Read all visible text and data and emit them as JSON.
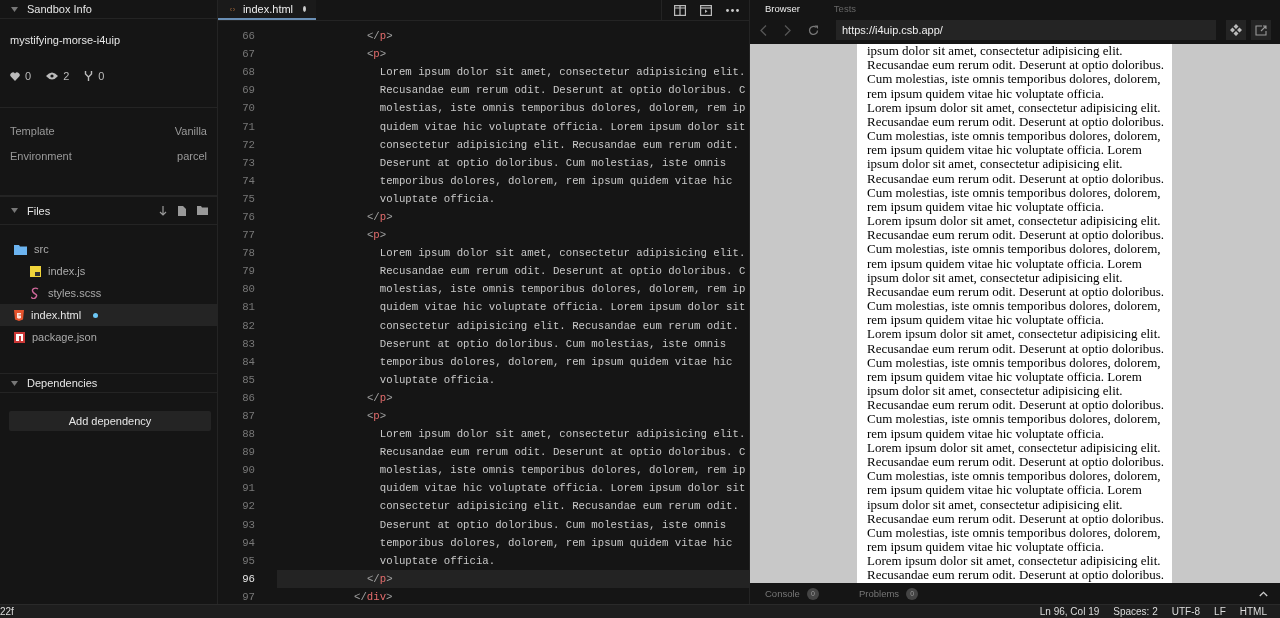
{
  "sidebar": {
    "info": {
      "title": "Sandbox Info",
      "name": "mystifying-morse-i4uip",
      "stats": [
        {
          "kind": "likes",
          "value": "0"
        },
        {
          "kind": "views",
          "value": "2"
        },
        {
          "kind": "forks",
          "value": "0"
        }
      ],
      "details": [
        {
          "label": "Template",
          "value": "Vanilla"
        },
        {
          "label": "Environment",
          "value": "parcel"
        }
      ]
    },
    "files": {
      "title": "Files",
      "items": [
        {
          "name": "src",
          "kind": "folder",
          "selected": false,
          "modified": false,
          "children": [
            {
              "name": "index.js",
              "kind": "js",
              "selected": false,
              "modified": false
            },
            {
              "name": "styles.scss",
              "kind": "scss",
              "selected": false,
              "modified": false
            }
          ]
        },
        {
          "name": "index.html",
          "kind": "html",
          "selected": true,
          "modified": true
        },
        {
          "name": "package.json",
          "kind": "json",
          "selected": false,
          "modified": false
        }
      ]
    },
    "dependencies": {
      "title": "Dependencies",
      "button": "Add dependency"
    }
  },
  "editor": {
    "tab": {
      "label": "index.html",
      "modified": true
    },
    "lines": [
      {
        "n": "66",
        "kind": "tag",
        "selected": false,
        "tokens": [
          {
            "t": "</",
            "kind": "punct"
          },
          {
            "t": "p",
            "kind": "tag"
          },
          {
            "t": ">",
            "kind": "punct"
          }
        ]
      },
      {
        "n": "67",
        "kind": "tag",
        "selected": false,
        "tokens": [
          {
            "t": "<",
            "kind": "punct"
          },
          {
            "t": "p",
            "kind": "tag"
          },
          {
            "t": ">",
            "kind": "punct"
          }
        ]
      },
      {
        "n": "68",
        "kind": "text",
        "selected": false,
        "tokens": [
          {
            "t": "Lorem ipsum dolor sit amet, consectetur adipisicing elit.",
            "kind": "text"
          }
        ]
      },
      {
        "n": "69",
        "kind": "text",
        "selected": false,
        "tokens": [
          {
            "t": "Recusandae eum rerum odit. Deserunt at optio doloribus. C",
            "kind": "text"
          }
        ]
      },
      {
        "n": "70",
        "kind": "text",
        "selected": false,
        "tokens": [
          {
            "t": "molestias, iste omnis temporibus dolores, dolorem, rem ip",
            "kind": "text"
          }
        ]
      },
      {
        "n": "71",
        "kind": "text",
        "selected": false,
        "tokens": [
          {
            "t": "quidem vitae hic voluptate officia. Lorem ipsum dolor sit",
            "kind": "text"
          }
        ]
      },
      {
        "n": "72",
        "kind": "text",
        "selected": false,
        "tokens": [
          {
            "t": "consectetur adipisicing elit. Recusandae eum rerum odit.",
            "kind": "text"
          }
        ]
      },
      {
        "n": "73",
        "kind": "text",
        "selected": false,
        "tokens": [
          {
            "t": "Deserunt at optio doloribus. Cum molestias, iste omnis",
            "kind": "text"
          }
        ]
      },
      {
        "n": "74",
        "kind": "text",
        "selected": false,
        "tokens": [
          {
            "t": "temporibus dolores, dolorem, rem ipsum quidem vitae hic",
            "kind": "text"
          }
        ]
      },
      {
        "n": "75",
        "kind": "text",
        "selected": false,
        "tokens": [
          {
            "t": "voluptate officia.",
            "kind": "text"
          }
        ]
      },
      {
        "n": "76",
        "kind": "tag",
        "selected": false,
        "tokens": [
          {
            "t": "</",
            "kind": "punct"
          },
          {
            "t": "p",
            "kind": "tag"
          },
          {
            "t": ">",
            "kind": "punct"
          }
        ]
      },
      {
        "n": "77",
        "kind": "tag",
        "selected": false,
        "tokens": [
          {
            "t": "<",
            "kind": "punct"
          },
          {
            "t": "p",
            "kind": "tag"
          },
          {
            "t": ">",
            "kind": "punct"
          }
        ]
      },
      {
        "n": "78",
        "kind": "text",
        "selected": false,
        "tokens": [
          {
            "t": "Lorem ipsum dolor sit amet, consectetur adipisicing elit.",
            "kind": "text"
          }
        ]
      },
      {
        "n": "79",
        "kind": "text",
        "selected": false,
        "tokens": [
          {
            "t": "Recusandae eum rerum odit. Deserunt at optio doloribus. C",
            "kind": "text"
          }
        ]
      },
      {
        "n": "80",
        "kind": "text",
        "selected": false,
        "tokens": [
          {
            "t": "molestias, iste omnis temporibus dolores, dolorem, rem ip",
            "kind": "text"
          }
        ]
      },
      {
        "n": "81",
        "kind": "text",
        "selected": false,
        "tokens": [
          {
            "t": "quidem vitae hic voluptate officia. Lorem ipsum dolor sit",
            "kind": "text"
          }
        ]
      },
      {
        "n": "82",
        "kind": "text",
        "selected": false,
        "tokens": [
          {
            "t": "consectetur adipisicing elit. Recusandae eum rerum odit.",
            "kind": "text"
          }
        ]
      },
      {
        "n": "83",
        "kind": "text",
        "selected": false,
        "tokens": [
          {
            "t": "Deserunt at optio doloribus. Cum molestias, iste omnis",
            "kind": "text"
          }
        ]
      },
      {
        "n": "84",
        "kind": "text",
        "selected": false,
        "tokens": [
          {
            "t": "temporibus dolores, dolorem, rem ipsum quidem vitae hic",
            "kind": "text"
          }
        ]
      },
      {
        "n": "85",
        "kind": "text",
        "selected": false,
        "tokens": [
          {
            "t": "voluptate officia.",
            "kind": "text"
          }
        ]
      },
      {
        "n": "86",
        "kind": "tag",
        "selected": false,
        "tokens": [
          {
            "t": "</",
            "kind": "punct"
          },
          {
            "t": "p",
            "kind": "tag"
          },
          {
            "t": ">",
            "kind": "punct"
          }
        ]
      },
      {
        "n": "87",
        "kind": "tag",
        "selected": false,
        "tokens": [
          {
            "t": "<",
            "kind": "punct"
          },
          {
            "t": "p",
            "kind": "tag"
          },
          {
            "t": ">",
            "kind": "punct"
          }
        ]
      },
      {
        "n": "88",
        "kind": "text",
        "selected": false,
        "tokens": [
          {
            "t": "Lorem ipsum dolor sit amet, consectetur adipisicing elit.",
            "kind": "text"
          }
        ]
      },
      {
        "n": "89",
        "kind": "text",
        "selected": false,
        "tokens": [
          {
            "t": "Recusandae eum rerum odit. Deserunt at optio doloribus. C",
            "kind": "text"
          }
        ]
      },
      {
        "n": "90",
        "kind": "text",
        "selected": false,
        "tokens": [
          {
            "t": "molestias, iste omnis temporibus dolores, dolorem, rem ip",
            "kind": "text"
          }
        ]
      },
      {
        "n": "91",
        "kind": "text",
        "selected": false,
        "tokens": [
          {
            "t": "quidem vitae hic voluptate officia. Lorem ipsum dolor sit",
            "kind": "text"
          }
        ]
      },
      {
        "n": "92",
        "kind": "text",
        "selected": false,
        "tokens": [
          {
            "t": "consectetur adipisicing elit. Recusandae eum rerum odit.",
            "kind": "text"
          }
        ]
      },
      {
        "n": "93",
        "kind": "text",
        "selected": false,
        "tokens": [
          {
            "t": "Deserunt at optio doloribus. Cum molestias, iste omnis",
            "kind": "text"
          }
        ]
      },
      {
        "n": "94",
        "kind": "text",
        "selected": false,
        "tokens": [
          {
            "t": "temporibus dolores, dolorem, rem ipsum quidem vitae hic",
            "kind": "text"
          }
        ]
      },
      {
        "n": "95",
        "kind": "text",
        "selected": false,
        "tokens": [
          {
            "t": "voluptate officia.",
            "kind": "text"
          }
        ]
      },
      {
        "n": "96",
        "kind": "tag",
        "selected": true,
        "tokens": [
          {
            "t": "</",
            "kind": "punct"
          },
          {
            "t": "p",
            "kind": "tag"
          },
          {
            "t": ">",
            "kind": "punct"
          }
        ]
      },
      {
        "n": "97",
        "kind": "outer",
        "selected": false,
        "tokens": [
          {
            "t": "</",
            "kind": "punct"
          },
          {
            "t": "div",
            "kind": "tag"
          },
          {
            "t": ">",
            "kind": "punct"
          }
        ]
      }
    ]
  },
  "preview": {
    "tabs": [
      {
        "label": "Browser",
        "selected": true
      },
      {
        "label": "Tests",
        "selected": false
      }
    ],
    "url": "https://i4uip.csb.app/",
    "lines": [
      "ipsum dolor sit amet, consectetur adipisicing elit.",
      "Recusandae eum rerum odit. Deserunt at optio doloribus.",
      "Cum molestias, iste omnis temporibus dolores, dolorem,",
      "rem ipsum quidem vitae hic voluptate officia.",
      "Lorem ipsum dolor sit amet, consectetur adipisicing elit.",
      "Recusandae eum rerum odit. Deserunt at optio doloribus.",
      "Cum molestias, iste omnis temporibus dolores, dolorem,",
      "rem ipsum quidem vitae hic voluptate officia. Lorem",
      "ipsum dolor sit amet, consectetur adipisicing elit.",
      "Recusandae eum rerum odit. Deserunt at optio doloribus.",
      "Cum molestias, iste omnis temporibus dolores, dolorem,",
      "rem ipsum quidem vitae hic voluptate officia.",
      "Lorem ipsum dolor sit amet, consectetur adipisicing elit.",
      "Recusandae eum rerum odit. Deserunt at optio doloribus.",
      "Cum molestias, iste omnis temporibus dolores, dolorem,",
      "rem ipsum quidem vitae hic voluptate officia. Lorem",
      "ipsum dolor sit amet, consectetur adipisicing elit.",
      "Recusandae eum rerum odit. Deserunt at optio doloribus.",
      "Cum molestias, iste omnis temporibus dolores, dolorem,",
      "rem ipsum quidem vitae hic voluptate officia.",
      "Lorem ipsum dolor sit amet, consectetur adipisicing elit.",
      "Recusandae eum rerum odit. Deserunt at optio doloribus.",
      "Cum molestias, iste omnis temporibus dolores, dolorem,",
      "rem ipsum quidem vitae hic voluptate officia. Lorem",
      "ipsum dolor sit amet, consectetur adipisicing elit.",
      "Recusandae eum rerum odit. Deserunt at optio doloribus.",
      "Cum molestias, iste omnis temporibus dolores, dolorem,",
      "rem ipsum quidem vitae hic voluptate officia.",
      "Lorem ipsum dolor sit amet, consectetur adipisicing elit.",
      "Recusandae eum rerum odit. Deserunt at optio doloribus.",
      "Cum molestias, iste omnis temporibus dolores, dolorem,",
      "rem ipsum quidem vitae hic voluptate officia. Lorem",
      "ipsum dolor sit amet, consectetur adipisicing elit.",
      "Recusandae eum rerum odit. Deserunt at optio doloribus.",
      "Cum molestias, iste omnis temporibus dolores, dolorem,",
      "rem ipsum quidem vitae hic voluptate officia.",
      "Lorem ipsum dolor sit amet, consectetur adipisicing elit.",
      "Recusandae eum rerum odit. Deserunt at optio doloribus."
    ],
    "panels": [
      {
        "label": "Console",
        "count": "0"
      },
      {
        "label": "Problems",
        "count": "0"
      }
    ]
  },
  "status_bar": {
    "left": "22f",
    "items": [
      "Ln 96, Col 19",
      "Spaces: 2",
      "UTF-8",
      "LF",
      "HTML"
    ]
  }
}
